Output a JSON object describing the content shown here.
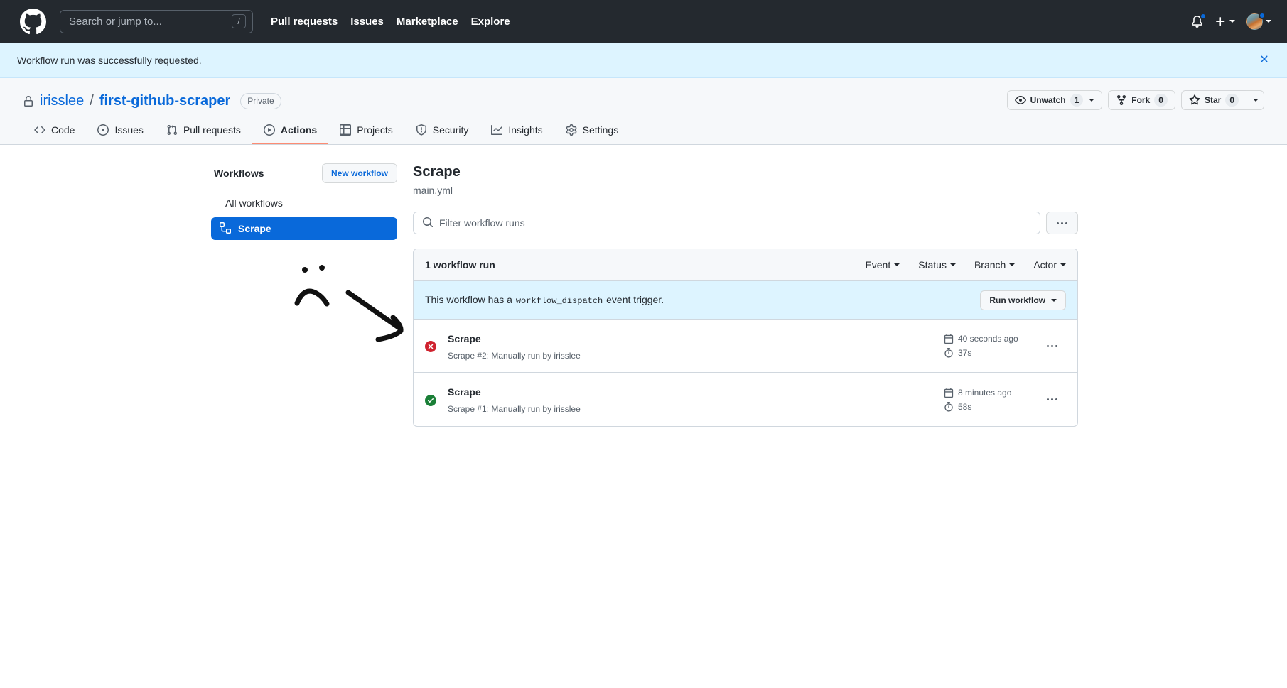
{
  "global_header": {
    "logo_icon": "github-mark-icon",
    "search": {
      "placeholder": "Search or jump to...",
      "shortcut": "/",
      "icon": "search-icon"
    },
    "nav": [
      {
        "label": "Pull requests"
      },
      {
        "label": "Issues"
      },
      {
        "label": "Marketplace"
      },
      {
        "label": "Explore"
      }
    ],
    "notifications_icon": "bell-icon",
    "has_unread_notifications": true,
    "create_new_icon": "plus-icon",
    "account_icon": "avatar",
    "accent_color": "#0969da",
    "background_color": "#24292f"
  },
  "flash": {
    "message": "Workflow run was successfully requested.",
    "close_icon": "close-icon",
    "background_color": "#ddf4ff"
  },
  "repo": {
    "visibility_icon": "lock-icon",
    "owner": "irisslee",
    "separator": "/",
    "name": "first-github-scraper",
    "visibility_badge": "Private",
    "actions": [
      {
        "name": "watch",
        "icon": "eye-icon",
        "label": "Unwatch",
        "count": "1",
        "has_caret": true
      },
      {
        "name": "fork",
        "icon": "fork-icon",
        "label": "Fork",
        "count": "0",
        "has_caret": false
      },
      {
        "name": "star",
        "icon": "star-icon",
        "label": "Star",
        "count": "0",
        "has_caret": false
      }
    ],
    "tabs": [
      {
        "label": "Code",
        "icon": "code-icon",
        "active": false
      },
      {
        "label": "Issues",
        "icon": "issue-opened-icon",
        "active": false
      },
      {
        "label": "Pull requests",
        "icon": "git-pull-request-icon",
        "active": false
      },
      {
        "label": "Actions",
        "icon": "play-icon",
        "active": true
      },
      {
        "label": "Projects",
        "icon": "table-icon",
        "active": false
      },
      {
        "label": "Security",
        "icon": "shield-icon",
        "active": false
      },
      {
        "label": "Insights",
        "icon": "graph-icon",
        "active": false
      },
      {
        "label": "Settings",
        "icon": "gear-icon",
        "active": false
      }
    ],
    "active_tab_underline_color": "#fd8c73"
  },
  "sidebar": {
    "heading": "Workflows",
    "new_workflow_button": "New workflow",
    "items": [
      {
        "label": "All workflows",
        "icon": null,
        "selected": false
      },
      {
        "label": "Scrape",
        "icon": "workflow-icon",
        "selected": true
      }
    ],
    "selected_background": "#0969da"
  },
  "workflow": {
    "title": "Scrape",
    "file": "main.yml",
    "filter": {
      "placeholder": "Filter workflow runs",
      "icon": "search-icon",
      "value": ""
    },
    "overflow_button_icon": "kebab-horizontal-icon",
    "runs_header": {
      "count_label": "1 workflow run",
      "filters": [
        {
          "label": "Event"
        },
        {
          "label": "Status"
        },
        {
          "label": "Branch"
        },
        {
          "label": "Actor"
        }
      ]
    },
    "dispatch_banner": {
      "text_before": "This workflow has a",
      "code": "workflow_dispatch",
      "text_after": "event trigger.",
      "button_label": "Run workflow"
    },
    "runs": [
      {
        "status": "failure",
        "status_icon": "x-circle-fill-icon",
        "status_color": "#cf222e",
        "name": "Scrape",
        "description": "Scrape #2: Manually run by irisslee",
        "time_icon": "calendar-icon",
        "time": "40 seconds ago",
        "duration_icon": "stopwatch-icon",
        "duration": "37s",
        "overflow_icon": "kebab-horizontal-icon"
      },
      {
        "status": "success",
        "status_icon": "check-circle-fill-icon",
        "status_color": "#1a7f37",
        "name": "Scrape",
        "description": "Scrape #1: Manually run by irisslee",
        "time_icon": "calendar-icon",
        "time": "8 minutes ago",
        "duration_icon": "stopwatch-icon",
        "duration": "58s",
        "overflow_icon": "kebab-horizontal-icon"
      }
    ]
  },
  "annotation": {
    "type": "hand-drawn",
    "elements": [
      "sad-face-drawing",
      "arrow-pointing-down-right"
    ],
    "color": "#000000"
  }
}
